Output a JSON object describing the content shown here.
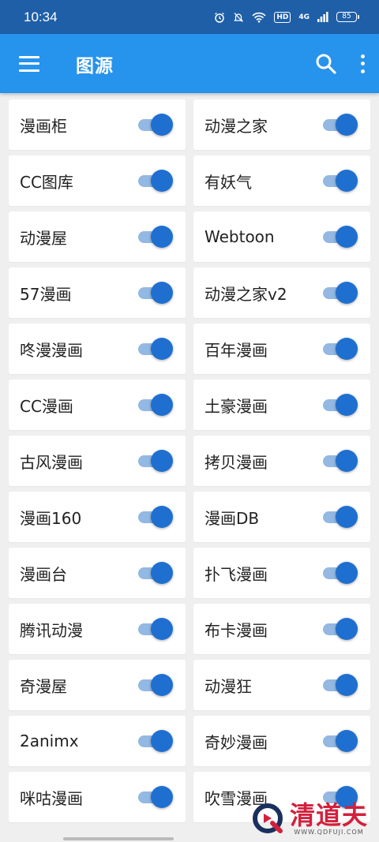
{
  "status_bar": {
    "time": "10:34",
    "network": "4G",
    "hd": "HD",
    "battery": "85"
  },
  "app_bar": {
    "title": "图源"
  },
  "sources": [
    {
      "label": "漫画柜",
      "enabled": true
    },
    {
      "label": "动漫之家",
      "enabled": true
    },
    {
      "label": "CC图库",
      "enabled": true
    },
    {
      "label": "有妖气",
      "enabled": true
    },
    {
      "label": "动漫屋",
      "enabled": true
    },
    {
      "label": "Webtoon",
      "enabled": true
    },
    {
      "label": "57漫画",
      "enabled": true
    },
    {
      "label": "动漫之家v2",
      "enabled": true
    },
    {
      "label": "咚漫漫画",
      "enabled": true
    },
    {
      "label": "百年漫画",
      "enabled": true
    },
    {
      "label": "CC漫画",
      "enabled": true
    },
    {
      "label": "土豪漫画",
      "enabled": true
    },
    {
      "label": "古风漫画",
      "enabled": true
    },
    {
      "label": "拷贝漫画",
      "enabled": true
    },
    {
      "label": "漫画160",
      "enabled": true
    },
    {
      "label": "漫画DB",
      "enabled": true
    },
    {
      "label": "漫画台",
      "enabled": true
    },
    {
      "label": "扑飞漫画",
      "enabled": true
    },
    {
      "label": "腾讯动漫",
      "enabled": true
    },
    {
      "label": "布卡漫画",
      "enabled": true
    },
    {
      "label": "奇漫屋",
      "enabled": true
    },
    {
      "label": "动漫狂",
      "enabled": true
    },
    {
      "label": "2animx",
      "enabled": true
    },
    {
      "label": "奇妙漫画",
      "enabled": true
    },
    {
      "label": "咪咕漫画",
      "enabled": true
    },
    {
      "label": "吹雪漫画",
      "enabled": true
    }
  ],
  "watermark": {
    "brand": "清道夫",
    "url": "WWW.QDFUJI.COM"
  },
  "colors": {
    "app_bar": "#2693ec",
    "status_bar": "#1f5fa8",
    "toggle_on": "#1f6fd1",
    "toggle_track": "#93b8e2"
  }
}
